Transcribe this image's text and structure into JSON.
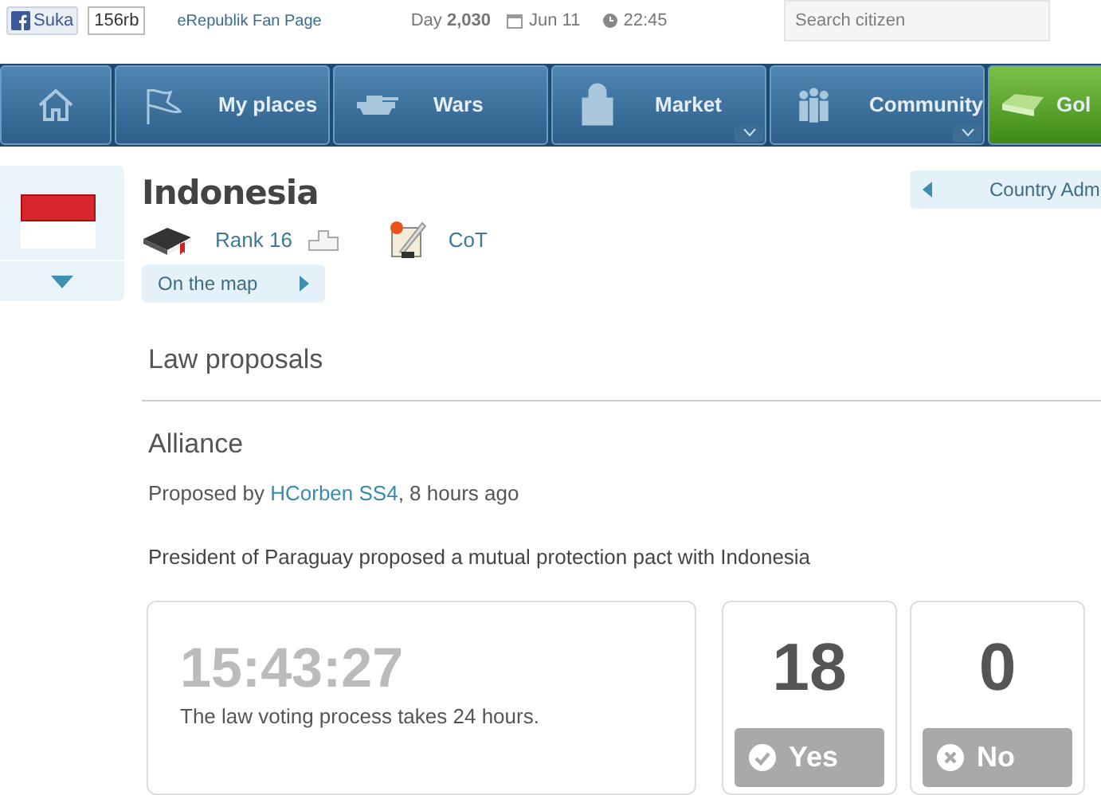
{
  "top_bar": {
    "like_button": "Suka",
    "like_count": "156rb",
    "fan_page_link": "eRepublik Fan Page",
    "day_label": "Day",
    "day": "2,030",
    "date": "Jun 11",
    "time": "22:45",
    "search": {
      "placeholder": "Search citizen"
    }
  },
  "nav": [
    {
      "kind": "home",
      "dropdown": false
    },
    {
      "kind": "places",
      "label": "My places",
      "dropdown": false
    },
    {
      "kind": "wars",
      "label": "Wars",
      "dropdown": false
    },
    {
      "kind": "market",
      "label": "Market",
      "dropdown": true
    },
    {
      "kind": "community",
      "label": "Community",
      "dropdown": true
    },
    {
      "kind": "gold",
      "label": "Gol",
      "dropdown": false
    }
  ],
  "country": {
    "name": "Indonesia",
    "rank": "Rank 16",
    "alliance": "CoT",
    "map_link": "On the map",
    "admin_tab": "Country Adm"
  },
  "section_title": "Law proposals",
  "proposal": {
    "title": "Alliance",
    "proposed_by": "Proposed by",
    "author": "HCorben SS4",
    "time_ago": ", 8 hours ago",
    "description": "President of Paraguay proposed a mutual protection pact with Indonesia",
    "timer": "15:43:27",
    "timer_note": "The law voting process takes 24 hours.",
    "votes": [
      {
        "kind": "yes",
        "count": "18",
        "label": "Yes",
        "disabled": true
      },
      {
        "kind": "no",
        "count": "0",
        "label": "No",
        "disabled": true
      }
    ]
  }
}
